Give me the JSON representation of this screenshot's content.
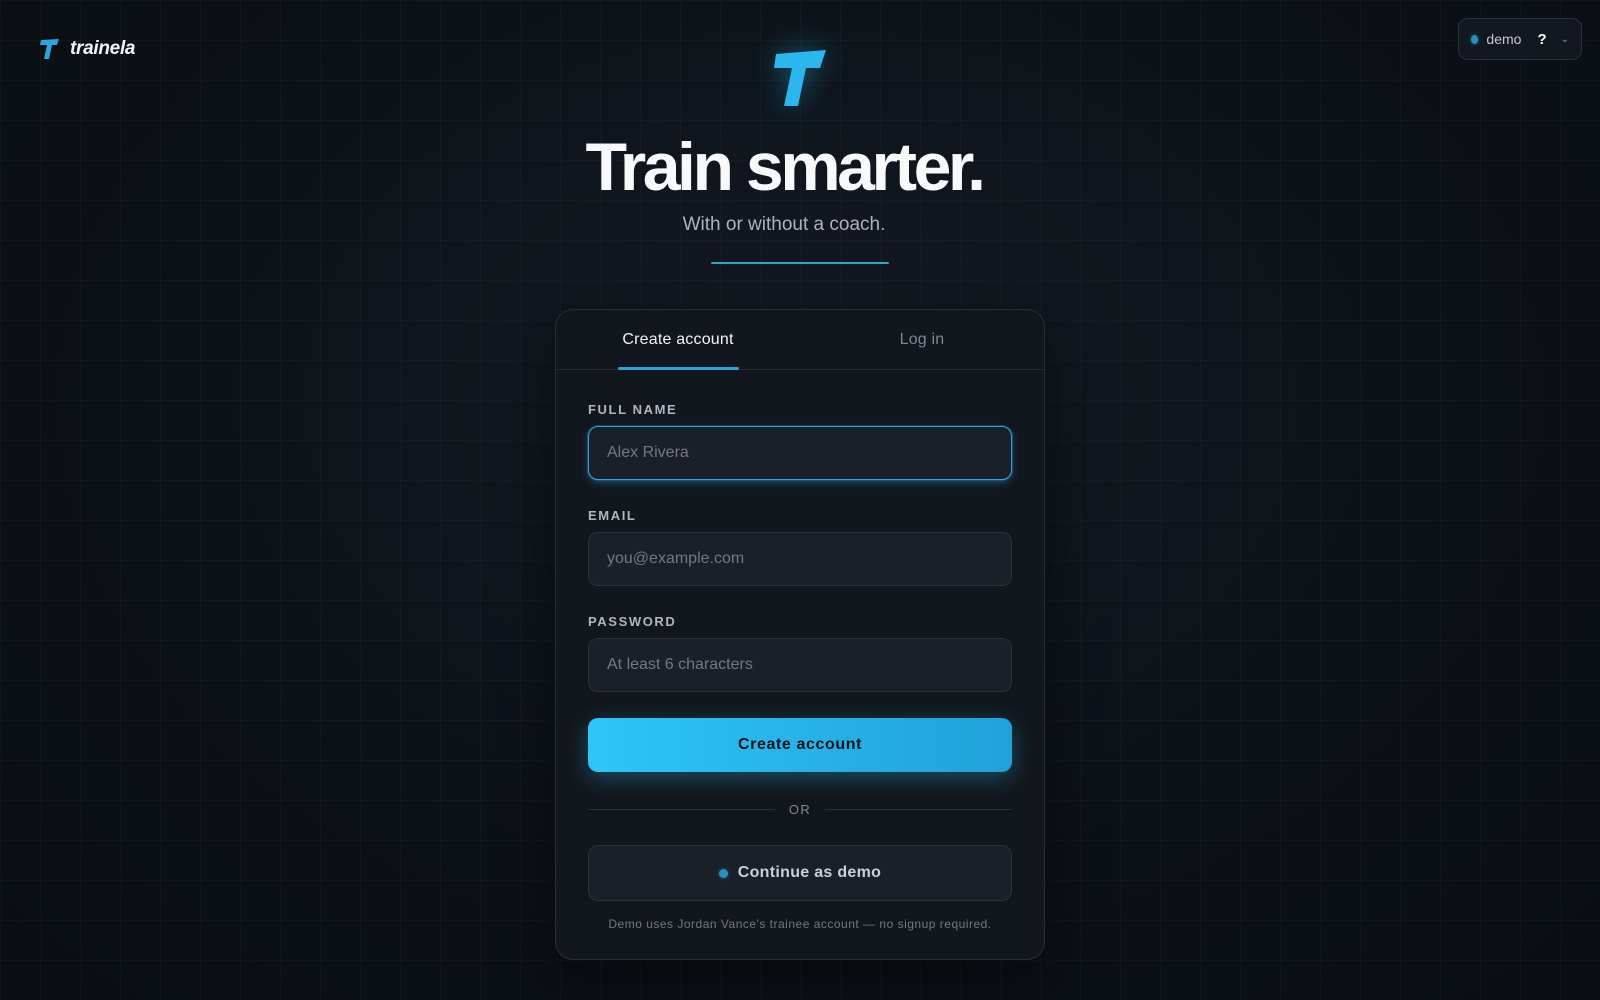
{
  "app": {
    "brand_name": "trainela",
    "brand_icon": "trainela-logo-icon",
    "accent_color": "#2aa7d8"
  },
  "header": {
    "mode_label": "demo",
    "help_label": "?",
    "dropdown_icon": "chevron-down-icon"
  },
  "hero": {
    "title": "Train smarter.",
    "subtitle": "With or without a coach."
  },
  "auth_card": {
    "tabs": [
      {
        "label": "Create account",
        "active": true
      },
      {
        "label": "Log in",
        "active": false
      }
    ],
    "fields": {
      "full_name": {
        "label": "FULL NAME",
        "placeholder": "Alex Rivera",
        "value": ""
      },
      "email": {
        "label": "EMAIL",
        "placeholder": "you@example.com",
        "value": ""
      },
      "password": {
        "label": "PASSWORD",
        "placeholder": "At least 6 characters",
        "value": ""
      }
    },
    "submit_label": "Create account",
    "divider_label": "OR",
    "demo_button_label": "Continue as demo",
    "demo_note": "Demo uses Jordan Vance's trainee account — no signup required."
  }
}
